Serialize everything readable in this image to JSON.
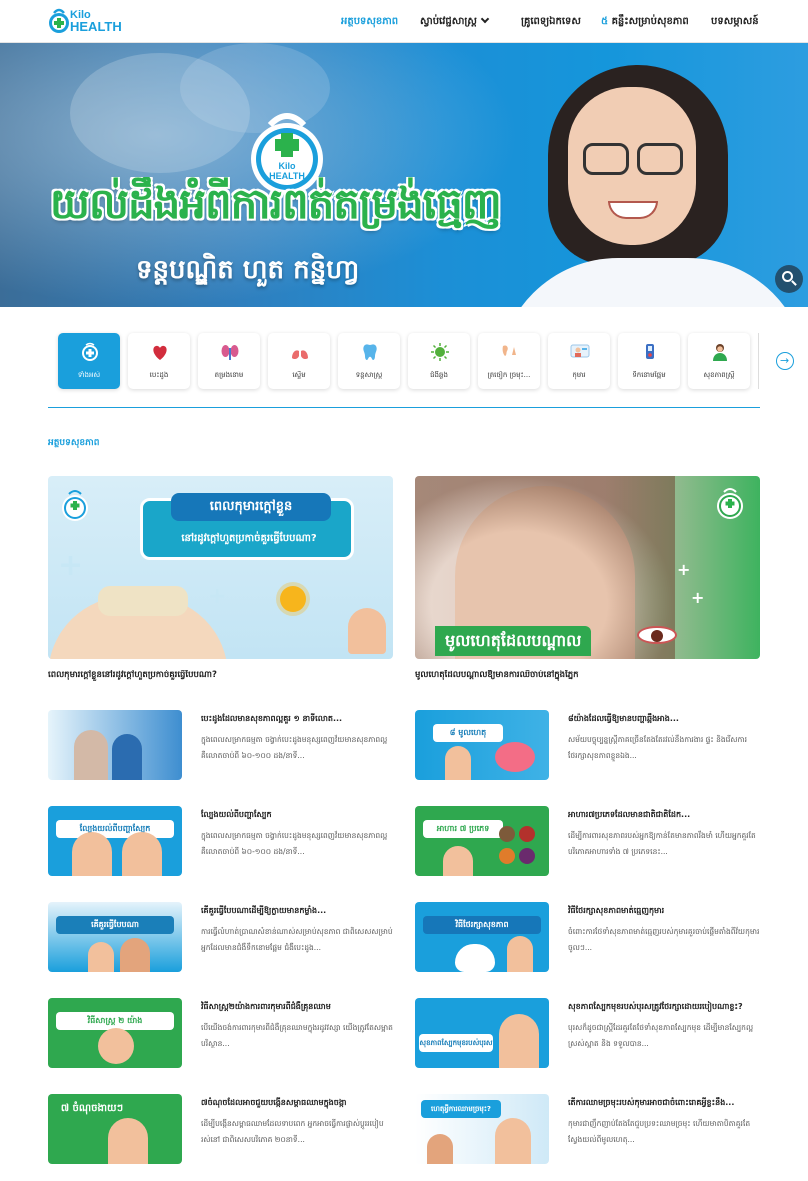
{
  "header": {
    "logo_line1": "Kilo",
    "logo_line2": "HEALTH",
    "nav": [
      {
        "label": "អត្ថបទសុខភាព",
        "active": true
      },
      {
        "label": "ស្វាប់វេជ្ជសាស្ត្រ",
        "active": false
      },
      {
        "label": "គ្រូពេទ្យឯកទេស",
        "active": false
      },
      {
        "label_hl": "៥",
        "label": " គន្លឹះសម្រាប់សុខភាព",
        "active": false
      },
      {
        "label": "បទសម្ភាសន៍",
        "active": false
      }
    ]
  },
  "banner": {
    "logo_line1": "Kilo",
    "logo_line2": "HEALTH",
    "title": "យល់ដឹងអំពីការពត់តម្រង់ធ្មេញ",
    "subtitle": "ទន្តបណ្ឌិត ហួត កន្និហា្វ"
  },
  "categories": [
    {
      "label": "ទាំងអស់",
      "icon": "all-health-icon",
      "active": true
    },
    {
      "label": "បេះដូង",
      "icon": "heart-icon",
      "active": false
    },
    {
      "label": "តម្រងនោម",
      "icon": "kidney-icon",
      "active": false
    },
    {
      "label": "ស្ទើម",
      "icon": "lungs-icon",
      "active": false
    },
    {
      "label": "ទន្តសាស្ត្រ",
      "icon": "tooth-icon",
      "active": false
    },
    {
      "label": "ជំងឺឆ្លង",
      "icon": "virus-icon",
      "active": false
    },
    {
      "label": "ត្រចៀក ច្រមុះ...",
      "icon": "ent-icon",
      "active": false
    },
    {
      "label": "កុមារ",
      "icon": "child-icon",
      "active": false
    },
    {
      "label": "ទឹកនោមផ្អែម",
      "icon": "diabetes-icon",
      "active": false
    },
    {
      "label": "សុខភាពស្ត្រី",
      "icon": "woman-icon",
      "active": false
    }
  ],
  "section_title": "អត្ថបទសុខភាព",
  "featured": [
    {
      "title": "ពេលកុមារក្តៅខ្លួននៅរដូវក្តៅហួតប្រកាច់គួរធ្វើបែបណា?",
      "image_text1": "ពេលកុមារក្ដៅខ្លួន",
      "image_text2": "នៅរដូវក្ដៅហួតប្រកាច់គួរធ្វើបែបណា?"
    },
    {
      "title": "មូលហេតុដែលបណ្ដាលឱ្យមានការឈឺចាប់នៅក្នុងភ្នែក",
      "image_text1": "មូលហេតុដែលបណ្ដាល"
    }
  ],
  "articles": [
    {
      "title": "បេះដូងដែលមានសុខភាពល្អគួរ ១ នាទីលោត...",
      "excerpt": "ក្នុងពេលសម្រាកធម្មតា ចង្វាក់បេះដូងមនុស្សពេញវ័យមានសុខភាពល្អ គឺលោតចាប់ពី ៦០-១០០ ដង/នាទី...",
      "thumb_text": ""
    },
    {
      "title": "៨យ៉ាងដែលធ្វើឱ្យមានបញ្ហាឆ្អឹងអាង...",
      "excerpt": "សម័យបច្ចុប្បន្នស្ត្រីភាគច្រើនតែងតែរវល់នឹងការងារ ផ្ទះ និងរើសការថែរក្សាសុខភាពខ្លួនឯង...",
      "thumb_text": "៨ មូលហេតុ"
    },
    {
      "title": "ល្បែងយល់ពីបញ្ហាស្បែក",
      "excerpt": "ក្នុងពេលសម្រាកធម្មតា ចង្វាក់បេះដូងមនុស្សពេញវ័យមានសុខភាពល្អ គឺលោតចាប់ពី ៦០-១០០ ដង/នាទី...",
      "thumb_text": "ល្បែងយល់ពីបញ្ហាស្បែក"
    },
    {
      "title": "អាហារ៧ប្រភេទដែលមានជាតិជាតិដែក...",
      "excerpt": "ដើម្បីការពារសុខភាពរបស់អ្នកឱ្យកាន់តែមានភាពរឹងមាំ ហើយអ្នកគួរតែបរិភោគអាហារទាំង ៧ ប្រភេទនេះ...",
      "thumb_text": "អាហារ ៧ ប្រភេទ"
    },
    {
      "title": "គើគួរធ្វើបែបណាដើម្បីឱ្យក្លាយមានកម្លាំង...",
      "excerpt": "ការធ្វើលំហាត់ប្រាណសំខាន់ណាស់សម្រាប់សុខភាព ជាពិសេសសម្រាប់អ្នកដែលមានជំងឺទឹកនោមផ្អែម ជំងឺបេះដូង...",
      "thumb_text": "គើគួរធ្វើបែបណា"
    },
    {
      "title": "វិធីថែរក្សាសុខភាពមាត់ធ្មេញកុមារ",
      "excerpt": "ចំពោះការថែទាំសុខភាពមាត់ធ្មេញរបស់កុមារគួរចាប់ផ្តើមតាំងពីវ័យកុមារចូលៗ...",
      "thumb_text": "វិធីថែរក្សាសុខភាព"
    },
    {
      "title": "វិធីសាស្ត្រ២យ៉ាងការពារកុមារពីជំងឺគ្រុនឈាម",
      "excerpt": "បើយើងចង់ការពារកុមារពីជំងឺគ្រុនឈាមក្នុងរដូវវស្សា យើងត្រូវតែសម្អាតបរិស្ថាន...",
      "thumb_text": "វិធីសាស្ត្រ ២ យ៉ាង"
    },
    {
      "title": "សុខភាពស្បែកមុខរបស់បុរសត្រូវថែរក្សាដោយរបៀបណាខ្លះ?",
      "excerpt": "បុរសក៏ដូចជាស្ត្រីដែរគួរតែថែទាំសុខភាពស្បែកមុខ ដើម្បីមានស្បែកល្អស្រស់ស្អាត និង ទទួលបាន...",
      "thumb_text": "សុខភាពស្បែកមុខរបស់បុរស"
    },
    {
      "title": "៧ចំណុចដែលអាចជួយបង្កើនសម្ពាធឈាមក្នុងចង្កា",
      "excerpt": "ដើម្បីបង្កើនសម្ពាធឈាមដែលទាបពេក អ្នកអាចធ្វើការផ្លាស់ប្តូររបៀបរស់នៅ ជាពិសេសបរិភោគ ២០នាទី...",
      "thumb_text": "៧ ចំណុចងាយៗ"
    },
    {
      "title": "តើការឈាមច្រមុះរបស់កុមារអាចជាចំពោះរោគអ្វីខ្លះនឹង...",
      "excerpt": "កុមារជាញឹកញាប់តែងតែជួបប្រទះឈាមច្រមុះ ហើយមាតាបិតាគួរតែស្វែងយល់ពីមូលហេតុ...",
      "thumb_text": "ហេតុអ្វីការឈាមច្រមុះ?"
    }
  ]
}
